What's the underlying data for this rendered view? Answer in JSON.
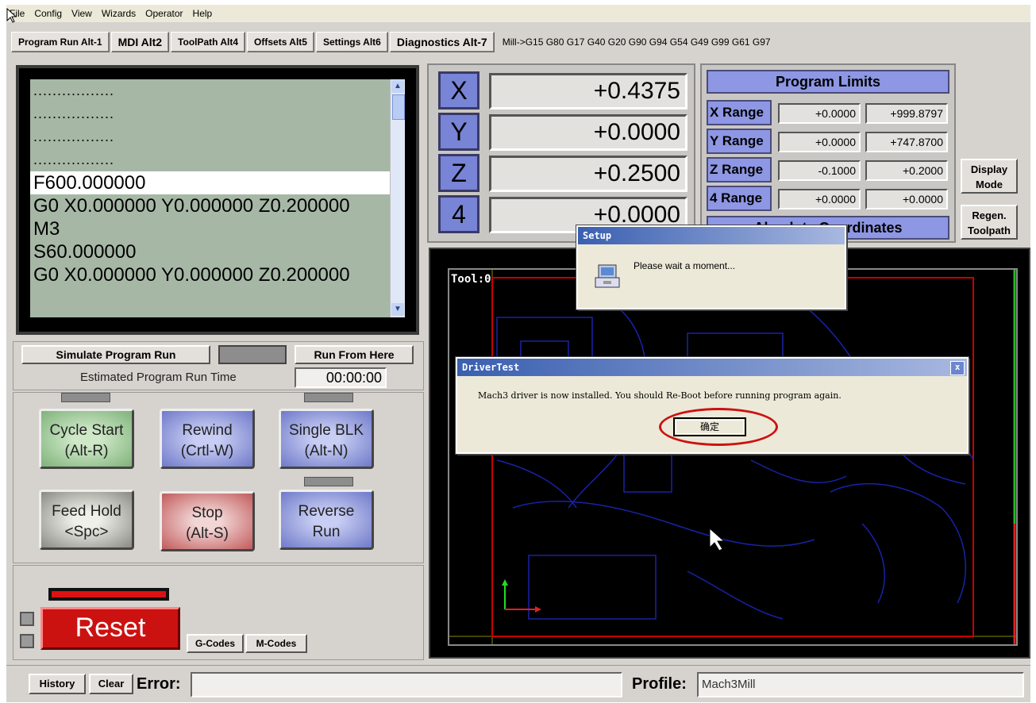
{
  "menu": [
    "File",
    "Config",
    "View",
    "Wizards",
    "Operator",
    "Help"
  ],
  "tabs": [
    "Program Run Alt-1",
    "MDI Alt2",
    "ToolPath Alt4",
    "Offsets Alt5",
    "Settings Alt6",
    "Diagnostics Alt-7"
  ],
  "modal_codes": "Mill->G15  G80 G17 G40 G20 G90 G94 G54 G49 G99 G61 G97",
  "gcode": {
    "lines": [
      ".................",
      ".................",
      ".................",
      ".................",
      "F600.000000",
      "G0 X0.000000 Y0.000000 Z0.200000",
      "M3",
      "S60.000000",
      "G0 X0.000000 Y0.000000 Z0.200000"
    ],
    "current_index": 4
  },
  "sim": {
    "simulate_label": "Simulate Program Run",
    "run_from_here_label": "Run From Here",
    "est_label": "Estimated Program Run Time",
    "est_value": "00:00:00"
  },
  "buttons": {
    "cycle_start": [
      "Cycle Start",
      "(Alt-R)"
    ],
    "rewind": [
      "Rewind",
      "(Crtl-W)"
    ],
    "single_blk": [
      "Single BLK",
      "(Alt-N)"
    ],
    "feed_hold": [
      "Feed Hold",
      "<Spc>"
    ],
    "stop": [
      "Stop",
      "(Alt-S)"
    ],
    "reverse_run": [
      "Reverse",
      "Run"
    ]
  },
  "reset_label": "Reset",
  "gcodes_label": "G-Codes",
  "mcodes_label": "M-Codes",
  "status": {
    "history_label": "History",
    "clear_label": "Clear",
    "error_label": "Error:",
    "error_value": "",
    "profile_label": "Profile:",
    "profile_value": "Mach3Mill"
  },
  "dro": [
    {
      "axis": "X",
      "value": "+0.4375"
    },
    {
      "axis": "Y",
      "value": "+0.0000"
    },
    {
      "axis": "Z",
      "value": "+0.2500"
    },
    {
      "axis": "4",
      "value": "+0.0000"
    }
  ],
  "limits": {
    "title": "Program Limits",
    "rows": [
      {
        "label": "X Range",
        "min": "+0.0000",
        "max": "+999.8797"
      },
      {
        "label": "Y Range",
        "min": "+0.0000",
        "max": "+747.8700"
      },
      {
        "label": "Z Range",
        "min": "-0.1000",
        "max": "+0.2000"
      },
      {
        "label": "4 Range",
        "min": "+0.0000",
        "max": "+0.0000"
      }
    ],
    "coords_label": "Absolute Coordinates"
  },
  "display_mode_label": [
    "Display",
    "Mode"
  ],
  "regen_label": [
    "Regen.",
    "Toolpath"
  ],
  "toolpath": {
    "tool_label": "Tool:0"
  },
  "setup_dialog": {
    "title": "Setup",
    "message": "Please wait a moment..."
  },
  "driver_dialog": {
    "title": "DriverTest",
    "message": "Mach3 driver is now installed. You should Re-Boot before running program again.",
    "ok_label": "确定",
    "close_glyph": "x"
  },
  "colors": {
    "highlight_ring": "#cc1111",
    "axis_blue": "#7884d6",
    "reset_red": "#cc1111"
  }
}
